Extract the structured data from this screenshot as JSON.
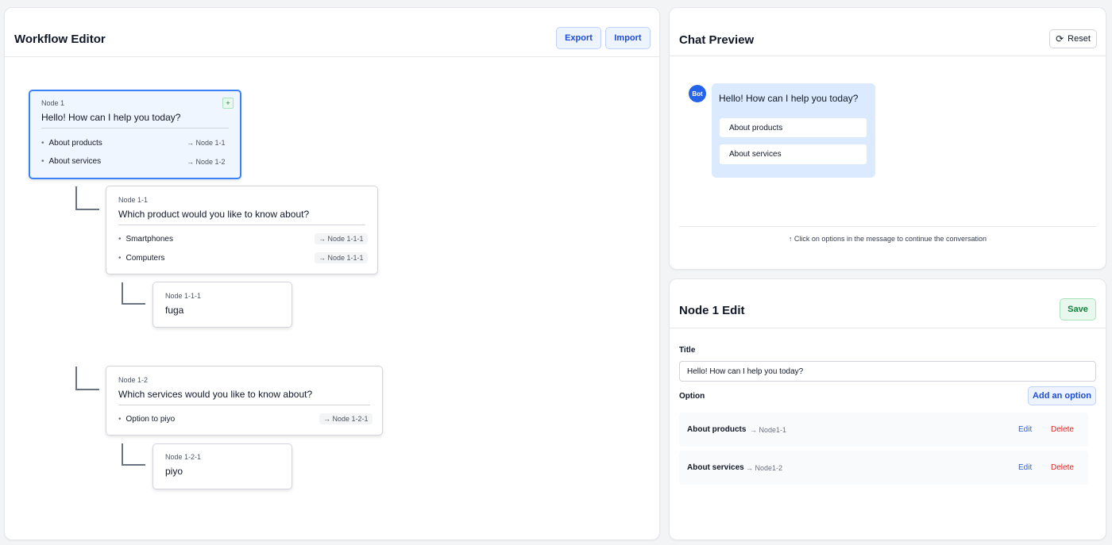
{
  "editor": {
    "title": "Workflow Editor",
    "export_label": "Export",
    "import_label": "Import",
    "nodes": {
      "n1": {
        "id": "Node 1",
        "title": "Hello! How can I help you today?",
        "add_label": "+",
        "options": [
          {
            "label": "About products",
            "link": "→ Node 1-1"
          },
          {
            "label": "About services",
            "link": "→ Node 1-2"
          }
        ]
      },
      "n11": {
        "id": "Node 1-1",
        "title": "Which product would you like to know about?",
        "options": [
          {
            "label": "Smartphones",
            "link": "→ Node 1-1-1"
          },
          {
            "label": "Computers",
            "link": "→ Node 1-1-1"
          }
        ]
      },
      "n111": {
        "id": "Node 1-1-1",
        "title": "fuga"
      },
      "n12": {
        "id": "Node 1-2",
        "title": "Which services would you like to know about?",
        "options": [
          {
            "label": "Option to piyo",
            "link": "→ Node 1-2-1"
          }
        ]
      },
      "n121": {
        "id": "Node 1-2-1",
        "title": "piyo"
      }
    },
    "bullet": "•"
  },
  "chat": {
    "title": "Chat Preview",
    "reset_label": "Reset",
    "avatar": "Bot",
    "message": "Hello! How can I help you today?",
    "options": [
      "About products",
      "About services"
    ],
    "hint": "↑ Click on options in the message to continue the conversation"
  },
  "edit": {
    "title": "Node 1 Edit",
    "save_label": "Save",
    "title_label": "Title",
    "title_value": "Hello! How can I help you today?",
    "option_label": "Option",
    "add_option_label": "Add an option",
    "options": [
      {
        "label": "About products",
        "link": "→ Node1-1"
      },
      {
        "label": "About services",
        "link": "→ Node1-2"
      }
    ],
    "edit_label": "Edit",
    "delete_label": "Delete"
  },
  "colors": {
    "accent": "#2563eb",
    "selected_border": "#3b82f6",
    "success": "#15803d",
    "danger": "#dc2626"
  },
  "icons": {
    "reset": "refresh-icon"
  }
}
